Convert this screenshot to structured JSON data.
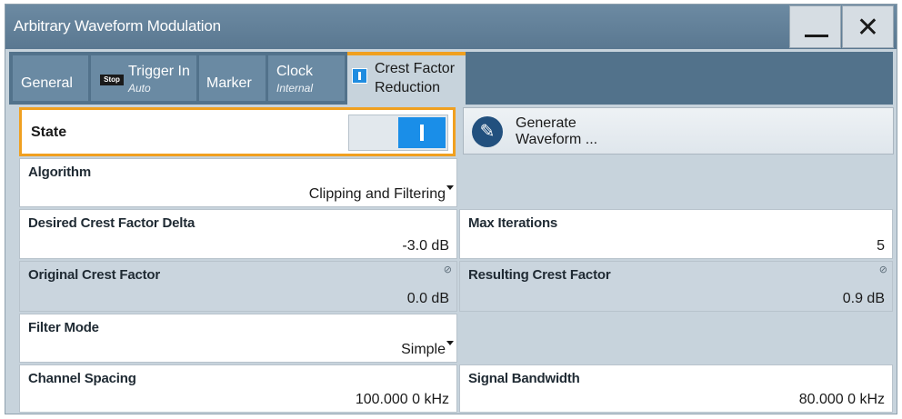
{
  "window": {
    "title": "Arbitrary Waveform Modulation"
  },
  "title_buttons": {
    "minimize_icon": "minimize-icon",
    "close_icon": "close-icon",
    "close_glyph": "✕"
  },
  "tabs": [
    {
      "label": "General",
      "sub": ""
    },
    {
      "label": "Trigger In",
      "sub": "Auto",
      "badge": "Stop"
    },
    {
      "label": "Marker",
      "sub": ""
    },
    {
      "label": "Clock",
      "sub": "Internal"
    },
    {
      "label_line1": "Crest Factor",
      "label_line2": "Reduction",
      "active": true
    }
  ],
  "state": {
    "label": "State",
    "value": "On"
  },
  "generate": {
    "label_line1": "Generate",
    "label_line2": "Waveform ...",
    "icon": "edit-waveform-icon"
  },
  "fields": {
    "algorithm": {
      "label": "Algorithm",
      "value": "Clipping and Filtering"
    },
    "desired_delta": {
      "label": "Desired Crest Factor Delta",
      "value": "-3.0 dB"
    },
    "max_iterations": {
      "label": "Max Iterations",
      "value": "5"
    },
    "original_cf": {
      "label": "Original Crest Factor",
      "value": "0.0 dB"
    },
    "resulting_cf": {
      "label": "Resulting Crest Factor",
      "value": "0.9 dB"
    },
    "filter_mode": {
      "label": "Filter Mode",
      "value": "Simple"
    },
    "channel_spacing": {
      "label": "Channel Spacing",
      "value": "100.000 0 kHz"
    },
    "signal_bandwidth": {
      "label": "Signal Bandwidth",
      "value": "80.000 0 kHz"
    }
  },
  "colors": {
    "accent": "#f0a020",
    "toggle_on": "#1a8ee8",
    "titlebar": "#5a7891",
    "panel": "#c7d3dc"
  }
}
